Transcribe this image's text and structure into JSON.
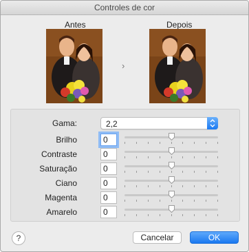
{
  "window": {
    "title": "Controles de cor"
  },
  "preview": {
    "before_label": "Antes",
    "after_label": "Depois",
    "separator_glyph": "›"
  },
  "controls": {
    "gamma": {
      "label": "Gama:",
      "value": "2,2"
    },
    "adjustments": [
      {
        "label": "Brilho",
        "value": "0",
        "slider_fraction": 0.5
      },
      {
        "label": "Contraste",
        "value": "0",
        "slider_fraction": 0.5
      },
      {
        "label": "Saturação",
        "value": "0",
        "slider_fraction": 0.5
      },
      {
        "label": "Ciano",
        "value": "0",
        "slider_fraction": 0.5
      },
      {
        "label": "Magenta",
        "value": "0",
        "slider_fraction": 0.5
      },
      {
        "label": "Amarelo",
        "value": "0",
        "slider_fraction": 0.5
      }
    ]
  },
  "footer": {
    "help_glyph": "?",
    "cancel_label": "Cancelar",
    "ok_label": "OK"
  },
  "colors": {
    "accent": "#1a78f0"
  },
  "icons": {
    "help": "help-icon",
    "select_stepper": "updown-chevron-icon",
    "separator": "chevron-right-icon"
  }
}
